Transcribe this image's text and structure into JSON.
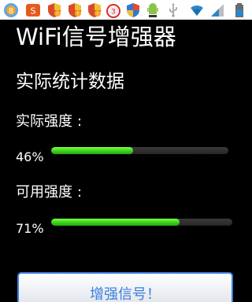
{
  "app": {
    "title": "WiFi信号增强器"
  },
  "section": {
    "title": "实际统计数据"
  },
  "metrics": [
    {
      "label": "实际强度",
      "colon": ":",
      "value_text": "46%",
      "fraction": 0.46
    },
    {
      "label": "可用强度",
      "colon": ":",
      "value_text": "71%",
      "fraction": 0.71
    }
  ],
  "button": {
    "label": "增强信号！"
  },
  "status_bar": {
    "icons": [
      "notification-badge-8-icon",
      "app-s-icon",
      "shield-alert-icon",
      "shield-alert-icon",
      "shield-alert-icon",
      "alarm-3-icon",
      "shield-icon",
      "android-robot-icon",
      "usb-icon",
      "wifi-icon",
      "signal-icon",
      "battery-icon"
    ]
  },
  "colors": {
    "progress_fill": "#3ad21a",
    "button_accent": "#3b7fe0",
    "background": "#000000"
  }
}
